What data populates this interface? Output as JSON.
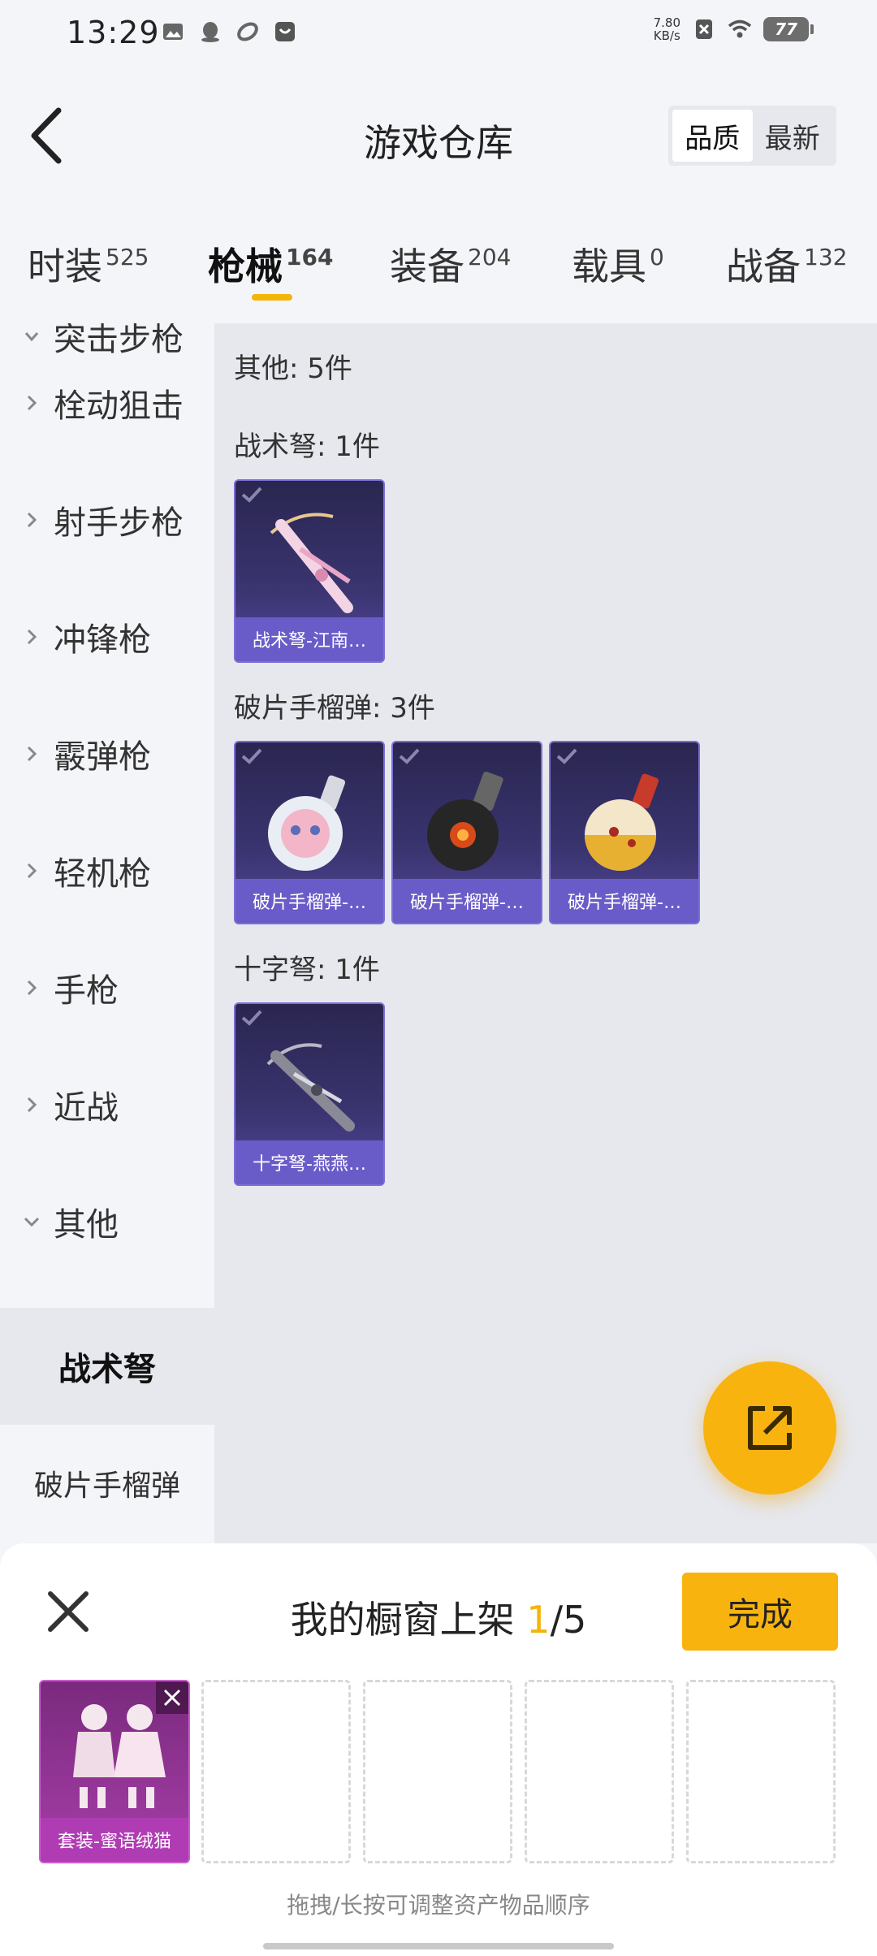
{
  "status_bar": {
    "time": "13:29",
    "net_speed_value": "7.80",
    "net_speed_unit": "KB/s",
    "battery": "77"
  },
  "header": {
    "title": "游戏仓库",
    "sort_quality": "品质",
    "sort_newest": "最新"
  },
  "tabs": [
    {
      "label": "时装",
      "count": "525"
    },
    {
      "label": "枪械",
      "count": "164"
    },
    {
      "label": "装备",
      "count": "204"
    },
    {
      "label": "载具",
      "count": "0"
    },
    {
      "label": "战备",
      "count": "132"
    }
  ],
  "sidebar": {
    "partial_item": "突击步枪",
    "items": [
      "栓动狙击",
      "射手步枪",
      "冲锋枪",
      "霰弹枪",
      "轻机枪",
      "手枪",
      "近战",
      "其他"
    ],
    "sub_items": [
      "战术弩",
      "破片手榴弹"
    ]
  },
  "content": {
    "summary": "其他: 5件",
    "sections": [
      {
        "title": "战术弩: 1件",
        "items": [
          "战术弩-江南…"
        ]
      },
      {
        "title": "破片手榴弹: 3件",
        "items": [
          "破片手榴弹-…",
          "破片手榴弹-…",
          "破片手榴弹-…"
        ]
      },
      {
        "title": "十字弩: 1件",
        "items": [
          "十字弩-燕燕…"
        ]
      }
    ]
  },
  "panel": {
    "title_prefix": "我的橱窗上架 ",
    "title_current": "1",
    "title_total": "/5",
    "done_label": "完成",
    "filled_item": "套装-蜜语绒猫",
    "hint": "拖拽/长按可调整资产物品顺序"
  },
  "colors": {
    "accent": "#f9b30f",
    "card_purple": "#6a5cc8",
    "card_magenta": "#b03cb4"
  }
}
